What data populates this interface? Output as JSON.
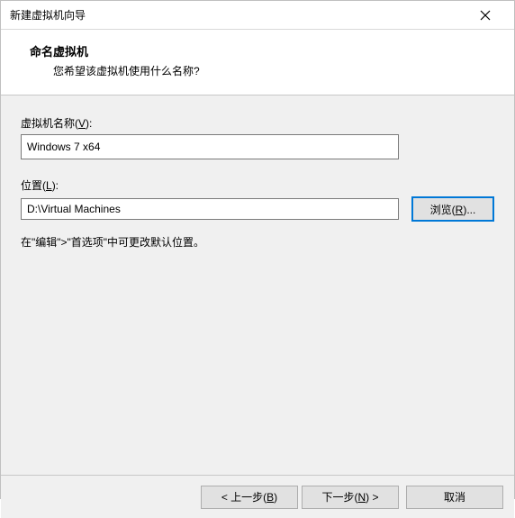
{
  "window": {
    "title": "新建虚拟机向导"
  },
  "header": {
    "title": "命名虚拟机",
    "subtitle": "您希望该虚拟机使用什么名称?"
  },
  "fields": {
    "name": {
      "label_pre": "虚拟机名称(",
      "label_key": "V",
      "label_post": "):",
      "value": "Windows 7 x64"
    },
    "location": {
      "label_pre": "位置(",
      "label_key": "L",
      "label_post": "):",
      "value": "D:\\Virtual Machines",
      "browse_pre": "浏览(",
      "browse_key": "R",
      "browse_post": ")..."
    }
  },
  "hint": "在\"编辑\">\"首选项\"中可更改默认位置。",
  "footer": {
    "back_pre": "< 上一步(",
    "back_key": "B",
    "back_post": ")",
    "next_pre": "下一步(",
    "next_key": "N",
    "next_post": ") >",
    "cancel": "取消"
  }
}
